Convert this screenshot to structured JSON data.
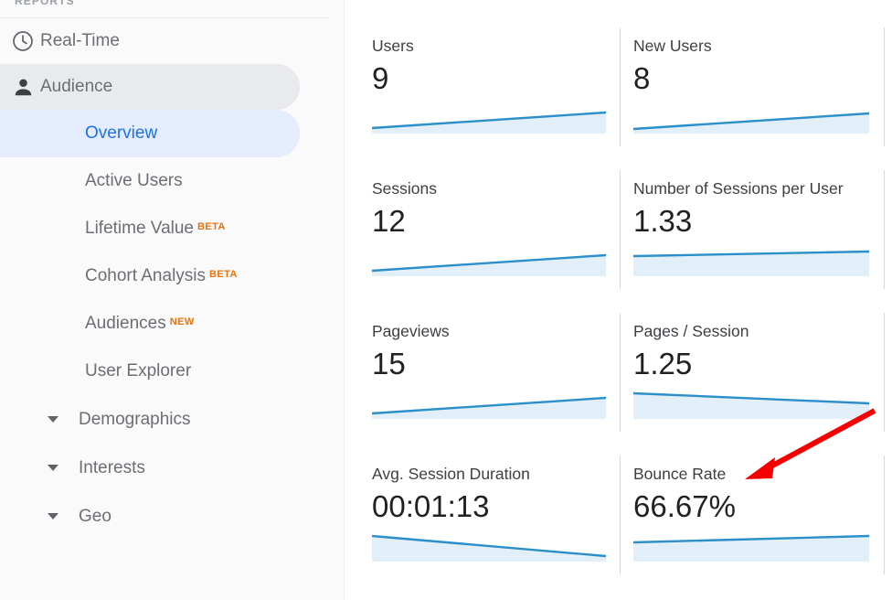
{
  "sidebar": {
    "section_label": "REPORTS",
    "items": [
      {
        "label": "Real-Time",
        "icon": "clock-icon",
        "type": "top",
        "state": "normal"
      },
      {
        "label": "Audience",
        "icon": "person-icon",
        "type": "top",
        "state": "active-grey"
      }
    ],
    "sub_items": [
      {
        "label": "Overview",
        "badge": "",
        "state": "active-blue"
      },
      {
        "label": "Active Users",
        "badge": "",
        "state": "normal"
      },
      {
        "label": "Lifetime Value",
        "badge": "BETA",
        "state": "normal"
      },
      {
        "label": "Cohort Analysis",
        "badge": "BETA",
        "state": "normal"
      },
      {
        "label": "Audiences",
        "badge": "NEW",
        "state": "normal"
      },
      {
        "label": "User Explorer",
        "badge": "",
        "state": "normal"
      }
    ],
    "expandable_items": [
      {
        "label": "Demographics",
        "icon": "chevron-down-icon"
      },
      {
        "label": "Interests",
        "icon": "chevron-down-icon"
      },
      {
        "label": "Geo",
        "icon": "chevron-down-icon"
      }
    ]
  },
  "metrics": [
    {
      "name": "Users",
      "value": "9"
    },
    {
      "name": "New Users",
      "value": "8"
    },
    {
      "name": "Sessions",
      "value": "12"
    },
    {
      "name": "Number of Sessions per User",
      "value": "1.33"
    },
    {
      "name": "Pageviews",
      "value": "15"
    },
    {
      "name": "Pages / Session",
      "value": "1.25"
    },
    {
      "name": "Avg. Session Duration",
      "value": "00:01:13"
    },
    {
      "name": "Bounce Rate",
      "value": "66.67%"
    }
  ],
  "annotation": {
    "type": "arrow",
    "color": "#f40000",
    "points_to": "Bounce Rate"
  },
  "colors": {
    "accent_blue": "#1a73e8",
    "sparkline_line": "#2b8fc9",
    "sparkline_fill": "#e3eff8",
    "badge_orange": "#e8710a",
    "sidebar_bg": "#fafafa",
    "active_grey": "#e8eaed",
    "active_blue": "#e4ecfd",
    "annotation_red": "#f40000"
  },
  "chart_data": [
    {
      "type": "line",
      "title": "Users",
      "x": [
        0,
        1,
        2,
        3
      ],
      "values": [
        9.5,
        17,
        26,
        35
      ],
      "ylim": [
        0,
        42
      ],
      "grid": false
    },
    {
      "type": "line",
      "title": "New Users",
      "x": [
        0,
        1,
        2,
        3
      ],
      "values": [
        7,
        14,
        22,
        31
      ],
      "ylim": [
        0,
        42
      ],
      "grid": false
    },
    {
      "type": "line",
      "title": "Sessions",
      "x": [
        0,
        1,
        2,
        3
      ],
      "values": [
        10,
        18,
        27,
        36
      ],
      "ylim": [
        0,
        42
      ],
      "grid": false
    },
    {
      "type": "line",
      "title": "Number of Sessions per User",
      "x": [
        0,
        1,
        2,
        3
      ],
      "values": [
        30,
        31,
        32,
        34
      ],
      "ylim": [
        0,
        42
      ],
      "grid": false
    },
    {
      "type": "line",
      "title": "Pageviews",
      "x": [
        0,
        1,
        2,
        3
      ],
      "values": [
        10,
        18,
        27,
        36
      ],
      "ylim": [
        0,
        42
      ],
      "grid": false
    },
    {
      "type": "line",
      "title": "Pages / Session",
      "x": [
        0,
        1,
        2,
        3
      ],
      "values": [
        34,
        31,
        27,
        23
      ],
      "ylim": [
        0,
        42
      ],
      "grid": false
    },
    {
      "type": "line",
      "title": "Avg. Session Duration",
      "x": [
        0,
        1,
        2,
        3
      ],
      "values": [
        35,
        28,
        20,
        12
      ],
      "ylim": [
        0,
        42
      ],
      "grid": false
    },
    {
      "type": "line",
      "title": "Bounce Rate",
      "x": [
        0,
        1,
        2,
        3
      ],
      "values": [
        28,
        31,
        33,
        35
      ],
      "ylim": [
        0,
        42
      ],
      "grid": false
    }
  ]
}
